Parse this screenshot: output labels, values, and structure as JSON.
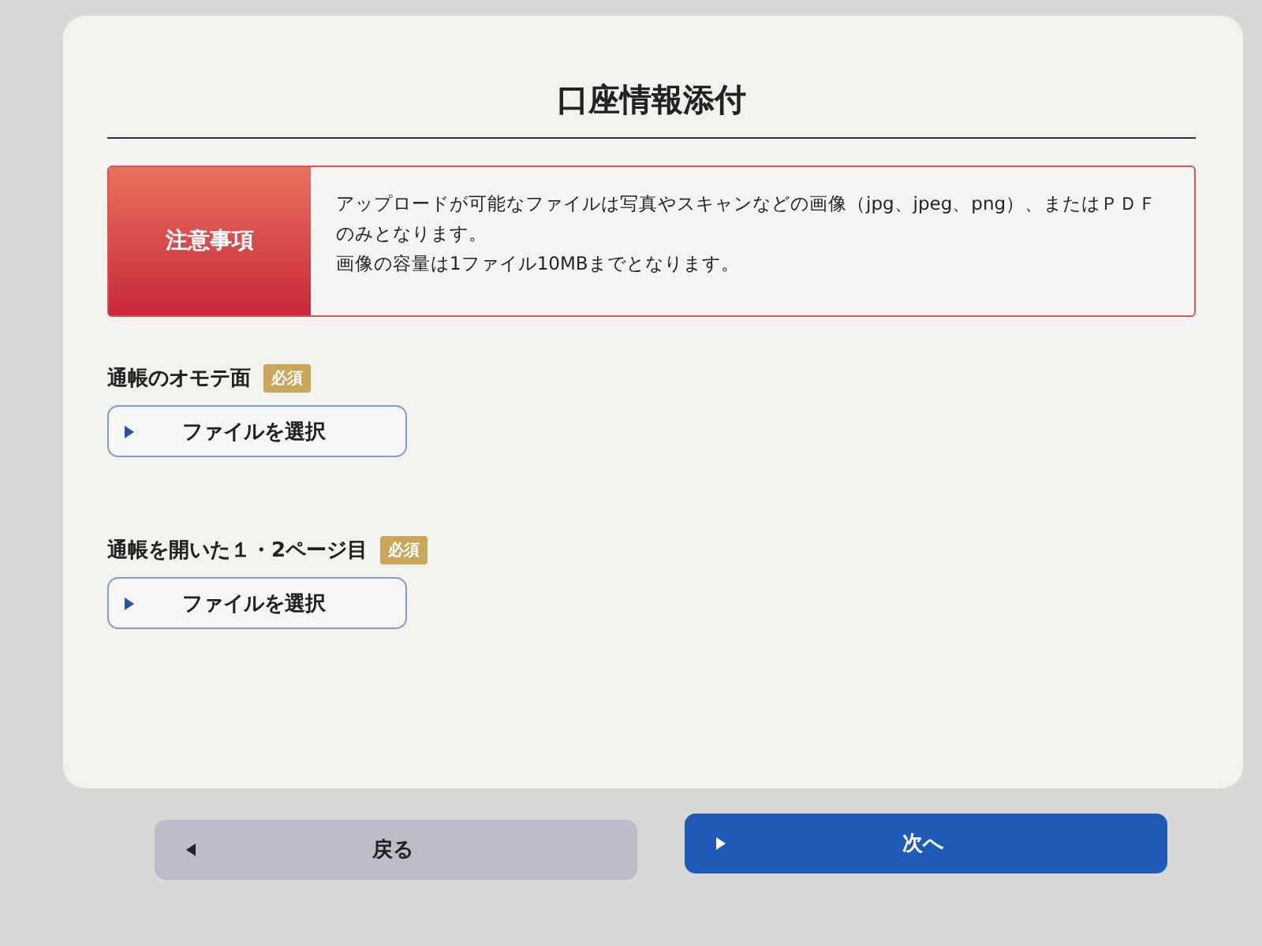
{
  "title": "口座情報添付",
  "notice": {
    "label": "注意事項",
    "lines": [
      "アップロードが可能なファイルは写真やスキャンなどの画像（jpg、jpeg、png）、またはＰＤＦのみとなります。",
      "画像の容量は1ファイル10MBまでとなります。"
    ]
  },
  "uploads": [
    {
      "label": "通帳のオモテ面",
      "badge": "必須",
      "button": "ファイルを選択"
    },
    {
      "label": "通帳を開いた１・2ページ目",
      "badge": "必須",
      "button": "ファイルを選択"
    }
  ],
  "buttons": [
    {
      "kind": "back",
      "label": "戻る"
    },
    {
      "kind": "next",
      "label": "次へ"
    }
  ]
}
